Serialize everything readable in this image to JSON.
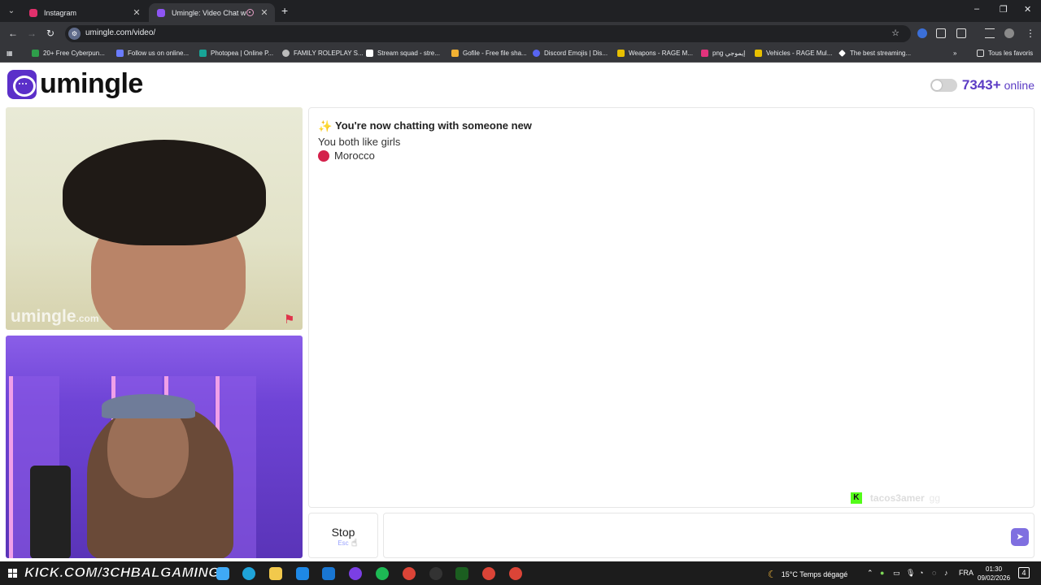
{
  "browser": {
    "tabs": [
      {
        "title": "Instagram",
        "active": false,
        "color": "#e1306c"
      },
      {
        "title": "Umingle: Video Chat with St",
        "active": true,
        "color": "#8e55f4"
      }
    ],
    "url": "umingle.com/video/",
    "bookmarks": [
      {
        "label": "20+ Free Cyberpun...",
        "icon": "bookmark-site-icon",
        "color": "#2e9e4a"
      },
      {
        "label": "Follow us on online...",
        "icon": "bookmark-arrow-icon",
        "color": "#6a7cff"
      },
      {
        "label": "Photopea | Online P...",
        "icon": "photopea-icon",
        "color": "#18a497"
      },
      {
        "label": "FAMILY ROLEPLAY S...",
        "icon": "globe-icon",
        "color": "#bbbbbb"
      },
      {
        "label": "Stream squad - stre...",
        "icon": "letter-s-icon",
        "color": "#ffffff"
      },
      {
        "label": "Gofile - Free file sha...",
        "icon": "folder-icon",
        "color": "#f2b233"
      },
      {
        "label": "Discord Emojis | Dis...",
        "icon": "discord-icon",
        "color": "#5865f2"
      },
      {
        "label": "Weapons - RAGE M...",
        "icon": "rage-icon",
        "color": "#e8c000"
      },
      {
        "label": "png إيموجي",
        "icon": "emoji-icon",
        "color": "#e2337d"
      },
      {
        "label": "Vehicles - RAGE Mul...",
        "icon": "rage-icon",
        "color": "#e8c000"
      },
      {
        "label": "The best streaming...",
        "icon": "diamond-icon",
        "color": "#ffffff"
      }
    ],
    "all_bookmarks": "Tous les favoris"
  },
  "app": {
    "brand": "umingle",
    "online_count": "7343+",
    "online_label": "online",
    "accent": "#5b3bc4",
    "video_watermark": "umingle",
    "video_watermark_suffix": ".com"
  },
  "chat": {
    "system_message": "You're now chatting with someone new",
    "common_interest": "You both like girls",
    "country": "Morocco",
    "country_color": "#d4214b",
    "overlay_handle": "tacos3amer",
    "overlay_suffix": "gg"
  },
  "controls": {
    "stop_label": "Stop",
    "stop_shortcut": "Esc",
    "message_placeholder": ""
  },
  "taskbar": {
    "stream_banner": "KICK.COM/3CHBALGAMING",
    "weather": "15°C  Temps dégagé",
    "language": "FRA",
    "time": "01:30",
    "date": "09/02/2026",
    "notification_count": "4"
  }
}
